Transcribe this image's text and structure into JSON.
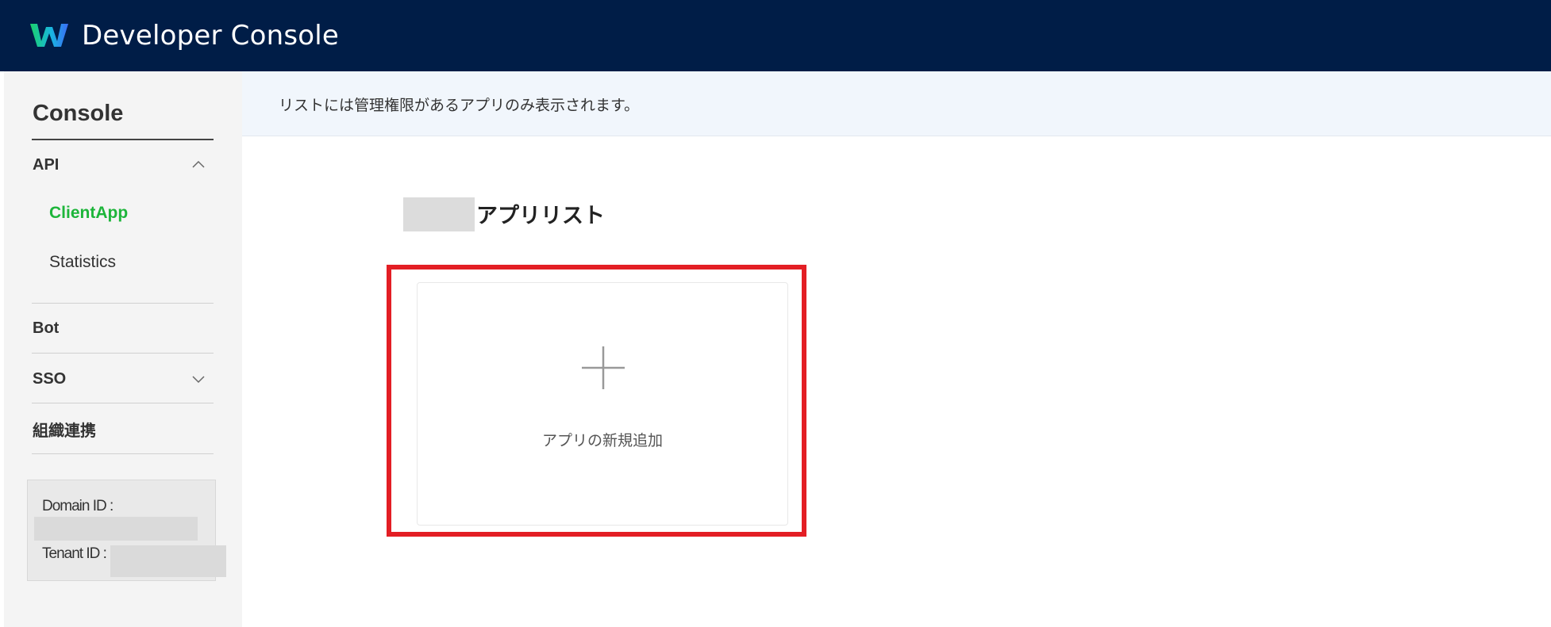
{
  "header": {
    "app_title": "Developer Console",
    "logo_icon": "works-logo-icon",
    "background": "#001d47"
  },
  "sidebar": {
    "title": "Console",
    "sections": [
      {
        "label": "API",
        "expanded": true,
        "icon": "chevron-up-icon"
      },
      {
        "label": "Bot"
      },
      {
        "label": "SSO",
        "expanded": false,
        "icon": "chevron-down-icon"
      },
      {
        "label": "組織連携"
      }
    ],
    "api_items": [
      {
        "label": "ClientApp",
        "active": true
      },
      {
        "label": "Statistics",
        "active": false
      }
    ],
    "active_color": "#1db53a",
    "info": {
      "domain_label": "Domain ID :",
      "tenant_label": "Tenant ID :"
    }
  },
  "main": {
    "notice": "リストには管理権限があるアプリのみ表示されます。",
    "list_title": "アプリリスト",
    "add_card": {
      "label": "アプリの新規追加",
      "icon": "plus-icon"
    },
    "highlight_color": "#e31e24"
  }
}
